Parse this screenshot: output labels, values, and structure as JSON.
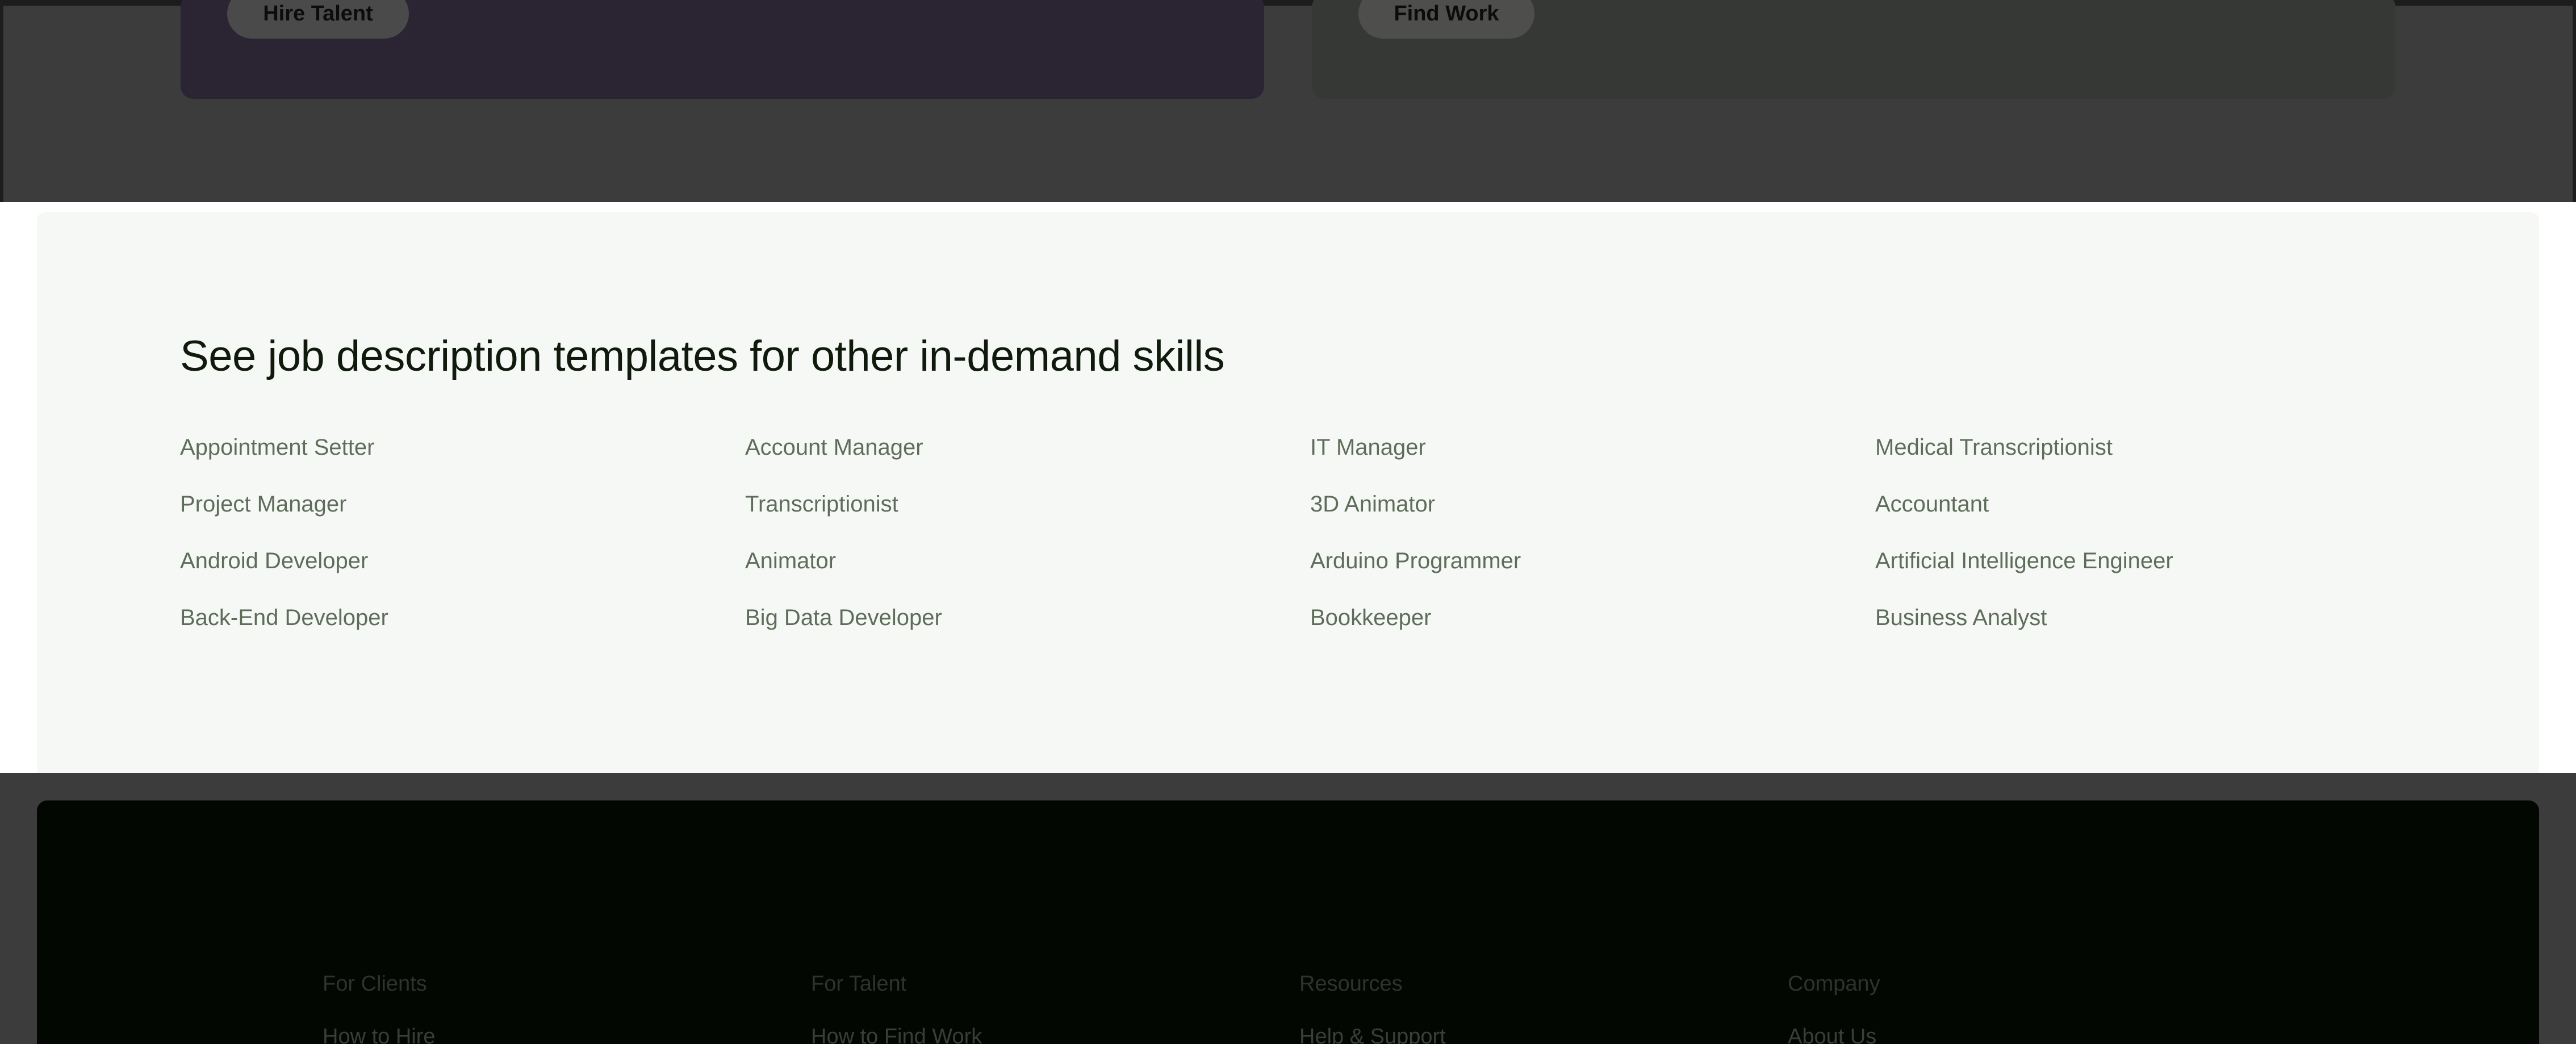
{
  "top_cards": {
    "clients_button": "Hire Talent",
    "talent_button": "Find Work",
    "colors": {
      "clients_card": "#2b2533",
      "talent_card": "#363835",
      "overlay": "#3c3c3c"
    }
  },
  "templates": {
    "title": "See job description templates for other in-demand skills",
    "columns": [
      [
        "Appointment Setter",
        "Project Manager",
        "Android Developer",
        "Back-End Developer"
      ],
      [
        "Account Manager",
        "Transcriptionist",
        "Animator",
        "Big Data Developer"
      ],
      [
        "IT Manager",
        "3D Animator",
        "Arduino Programmer",
        "Bookkeeper"
      ],
      [
        "Medical Transcriptionist",
        "Accountant",
        "Artificial Intelligence Engineer",
        "Business Analyst"
      ]
    ],
    "colors": {
      "background": "#f6f8f5",
      "title": "#0f1a0d",
      "link": "#5e6d5a"
    }
  },
  "footer": {
    "columns": [
      {
        "heading": "For Clients",
        "first_link": "How to Hire"
      },
      {
        "heading": "For Talent",
        "first_link": "How to Find Work"
      },
      {
        "heading": "Resources",
        "first_link": "Help & Support"
      },
      {
        "heading": "Company",
        "first_link": "About Us"
      }
    ],
    "colors": {
      "background": "#020702"
    }
  }
}
